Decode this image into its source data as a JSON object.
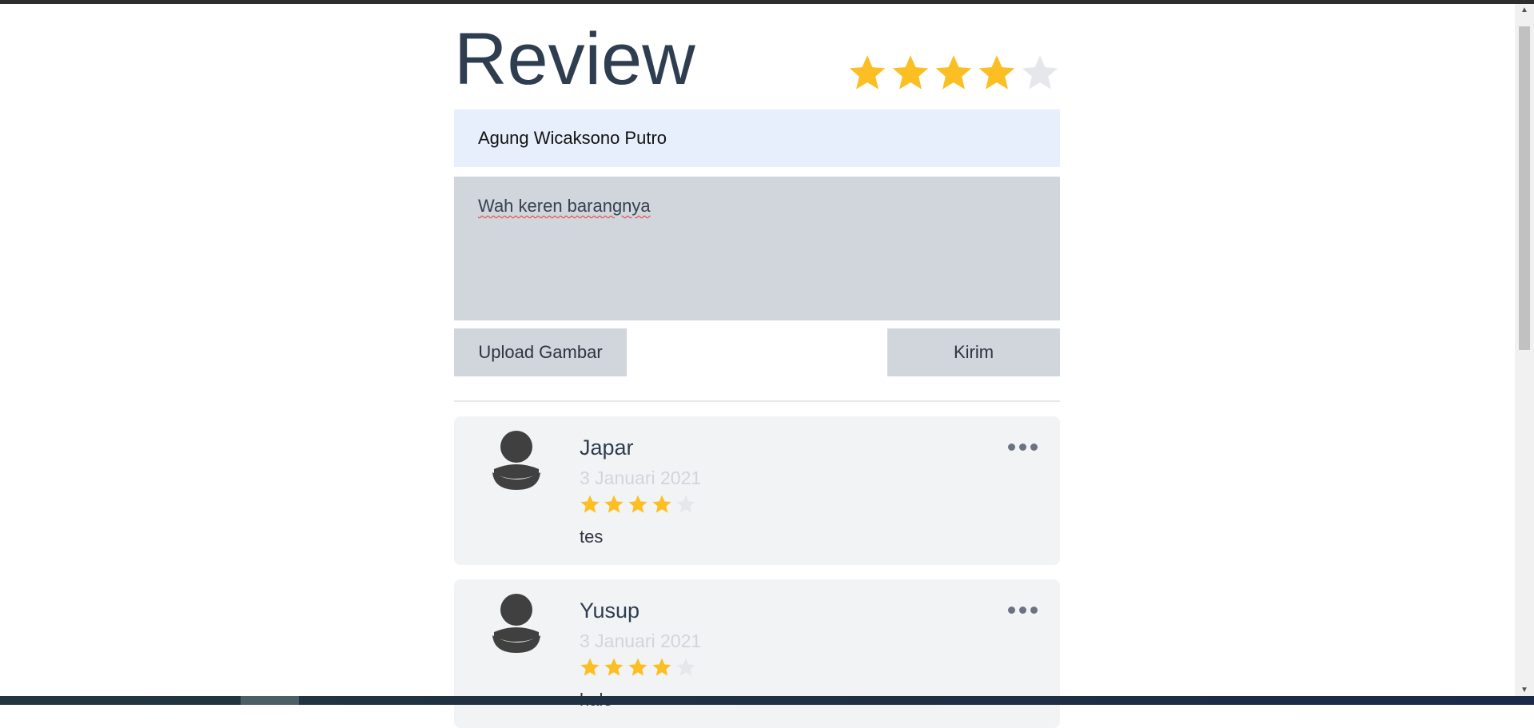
{
  "header": {
    "title": "Review",
    "rating": 4,
    "max_rating": 5
  },
  "form": {
    "name_value": "Agung Wicaksono Putro",
    "review_value": "Wah keren barangnya",
    "upload_label": "Upload Gambar",
    "submit_label": "Kirim"
  },
  "reviews": [
    {
      "name": "Japar",
      "date": "3 Januari 2021",
      "rating": 4,
      "text": "tes"
    },
    {
      "name": "Yusup",
      "date": "3 Januari 2021",
      "rating": 4,
      "text": "halo"
    }
  ],
  "colors": {
    "star_on": "#fbbf24",
    "star_off": "#e5e7eb",
    "title": "#2e3e50"
  }
}
